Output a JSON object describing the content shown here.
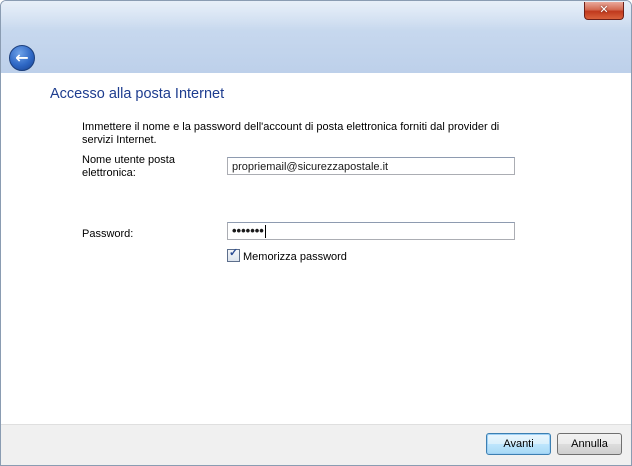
{
  "window": {
    "close_symbol": "✕",
    "back_symbol": "←"
  },
  "main": {
    "heading": "Accesso alla posta Internet",
    "intro": "Immettere il nome e la password dell'account di posta elettronica forniti dal provider di servizi Internet.",
    "username_label": "Nome utente posta elettronica:",
    "username_value": "propriemail@sicurezzapostale.it",
    "password_label": "Password:",
    "password_value": "•••••••",
    "remember_label": "Memorizza password",
    "remember_checked": true
  },
  "footer": {
    "next_label": "Avanti",
    "cancel_label": "Annulla"
  },
  "icons": {
    "close": "close-icon",
    "back": "back-arrow-icon",
    "check": "checkmark-icon"
  },
  "colors": {
    "heading": "#1e3d8f",
    "titlebar": "#c7d8ee",
    "close_button": "#c0391d",
    "back_button": "#2f68c5"
  }
}
